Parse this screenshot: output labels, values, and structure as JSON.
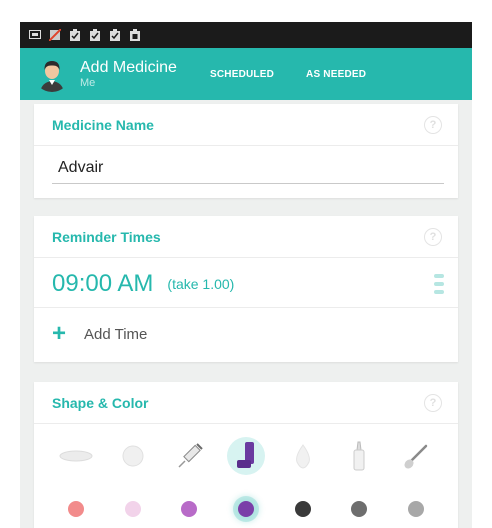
{
  "app": {
    "title": "Add Medicine",
    "profile": "Me"
  },
  "tabs": [
    {
      "label": "SCHEDULED"
    },
    {
      "label": "AS NEEDED"
    }
  ],
  "medicine_name": {
    "title": "Medicine Name",
    "value": "Advair",
    "help": "?"
  },
  "reminder": {
    "title": "Reminder Times",
    "help": "?",
    "time": "09:00 AM",
    "take": "(take 1.00)",
    "add_time": "Add Time",
    "add_icon": "+"
  },
  "shape_color": {
    "title": "Shape & Color",
    "help": "?",
    "shapes": [
      "oval-pill",
      "round-pill",
      "syringe",
      "inhaler",
      "drop",
      "dropper-bottle",
      "brush"
    ],
    "selected_shape": "inhaler",
    "colors": [
      "#f28b8b",
      "#f2d3ea",
      "#b86bc8",
      "#7a3fa8",
      "#3a3a3a",
      "#6e6e6e",
      "#a8a8a8"
    ],
    "selected_color": "#7a3fa8"
  },
  "theme": {
    "accent": "#26b8ad",
    "statusbar": "#1b1b1b"
  },
  "statusbar_icons": [
    "screen-icon",
    "no-image-icon",
    "clipboard-check-icon",
    "clipboard-check-icon",
    "clipboard-check-icon",
    "clipboard-icon"
  ]
}
